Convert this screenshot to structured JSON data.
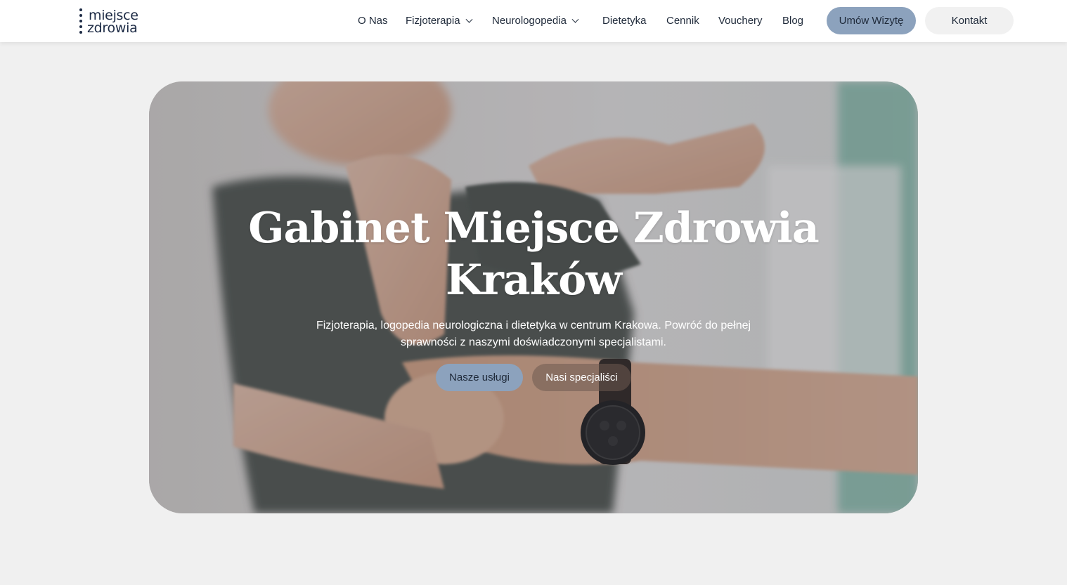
{
  "logo": {
    "line1": "miejsce",
    "line2": "zdrowia"
  },
  "nav": {
    "items": [
      {
        "label": "O Nas",
        "dropdown": false
      },
      {
        "label": "Fizjoterapia",
        "dropdown": true
      },
      {
        "label": "Neurologopedia",
        "dropdown": true
      },
      {
        "label": "Dietetyka",
        "dropdown": false
      },
      {
        "label": "Cennik",
        "dropdown": false
      },
      {
        "label": "Vouchery",
        "dropdown": false
      },
      {
        "label": "Blog",
        "dropdown": false
      }
    ],
    "cta_primary": "Umów Wizytę",
    "cta_secondary": "Kontakt"
  },
  "hero": {
    "title_line1": "Gabinet Miejsce Zdrowia",
    "title_line2": "Kraków",
    "subtitle": "Fizjoterapia, logopedia neurologiczna i dietetyka w centrum Krakowa. Powróć do pełnej sprawności z naszymi doświadczonymi specjalistami.",
    "btn_services": "Nasze usługi",
    "btn_specialists": "Nasi specjaliści"
  },
  "colors": {
    "accent": "#8ca2bd",
    "text_dark": "#1f2a3a",
    "page_bg": "#f0f0f0"
  }
}
